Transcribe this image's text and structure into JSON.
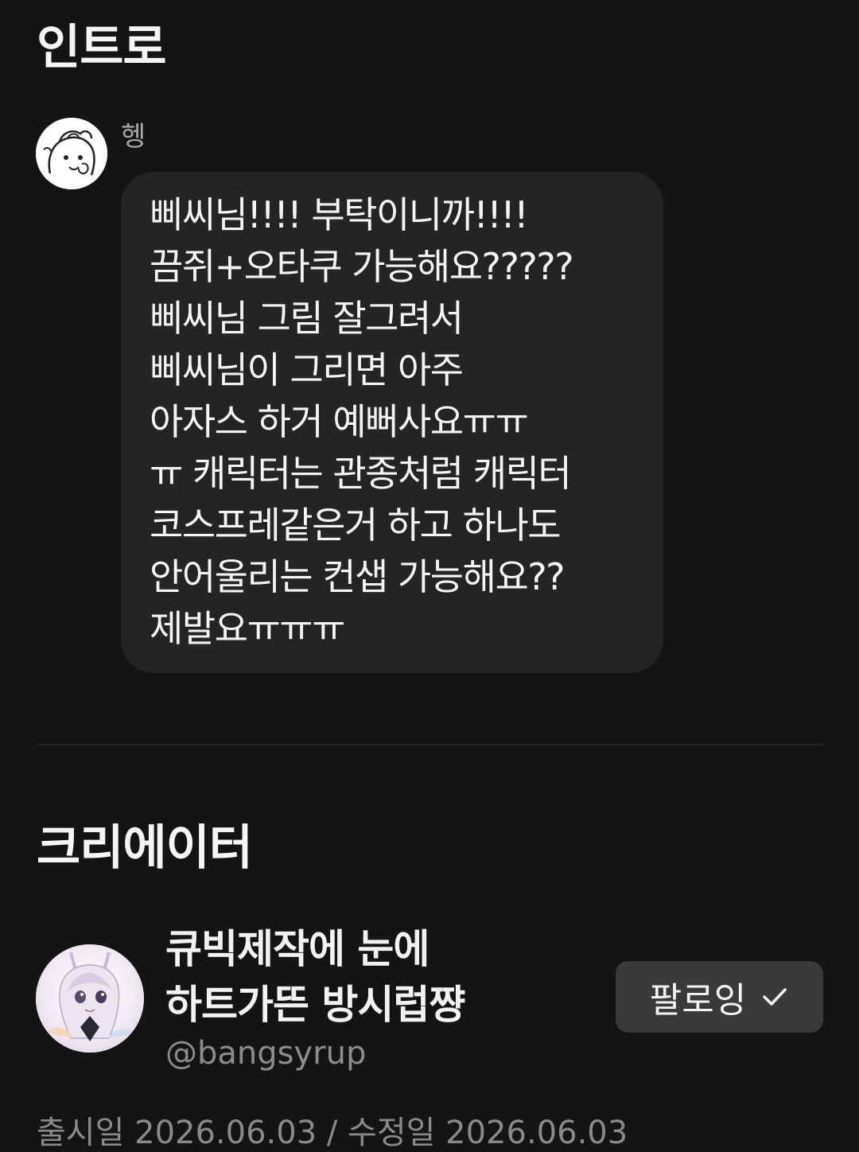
{
  "intro": {
    "title": "인트로",
    "requester": {
      "name": "헹",
      "avatar_icon": "sketch-character-avatar"
    },
    "message_lines": [
      "삐씨님!!!! 부탁이니까!!!!",
      "끔쥐+오타쿠 가능해요?????",
      "삐씨님 그림 잘그려서",
      "삐씨님이 그리면 아주",
      "아자스 하거 예뻐사요ㅠㅠ",
      "ㅠ 캐릭터는 관종처럼 캐릭터",
      "코스프레같은거 하고 하나도",
      "안어울리는 컨샙 가능해요??",
      "제발요ㅠㅠㅠ"
    ]
  },
  "creator": {
    "title": "크리에이터",
    "name_lines": [
      "큐빅제작에 눈에",
      "하트가뜬 방시럽쨩"
    ],
    "handle": "@bangsyrup",
    "avatar_icon": "anime-character-avatar",
    "follow_label": "팔로잉",
    "follow_icon": "check-icon"
  },
  "release_info": "출시일 2026.06.03 / 수정일 2026.06.03",
  "colors": {
    "background": "#141414",
    "bubble": "#242424",
    "button": "#3a3a3a",
    "muted_text": "#8c8c8c"
  }
}
